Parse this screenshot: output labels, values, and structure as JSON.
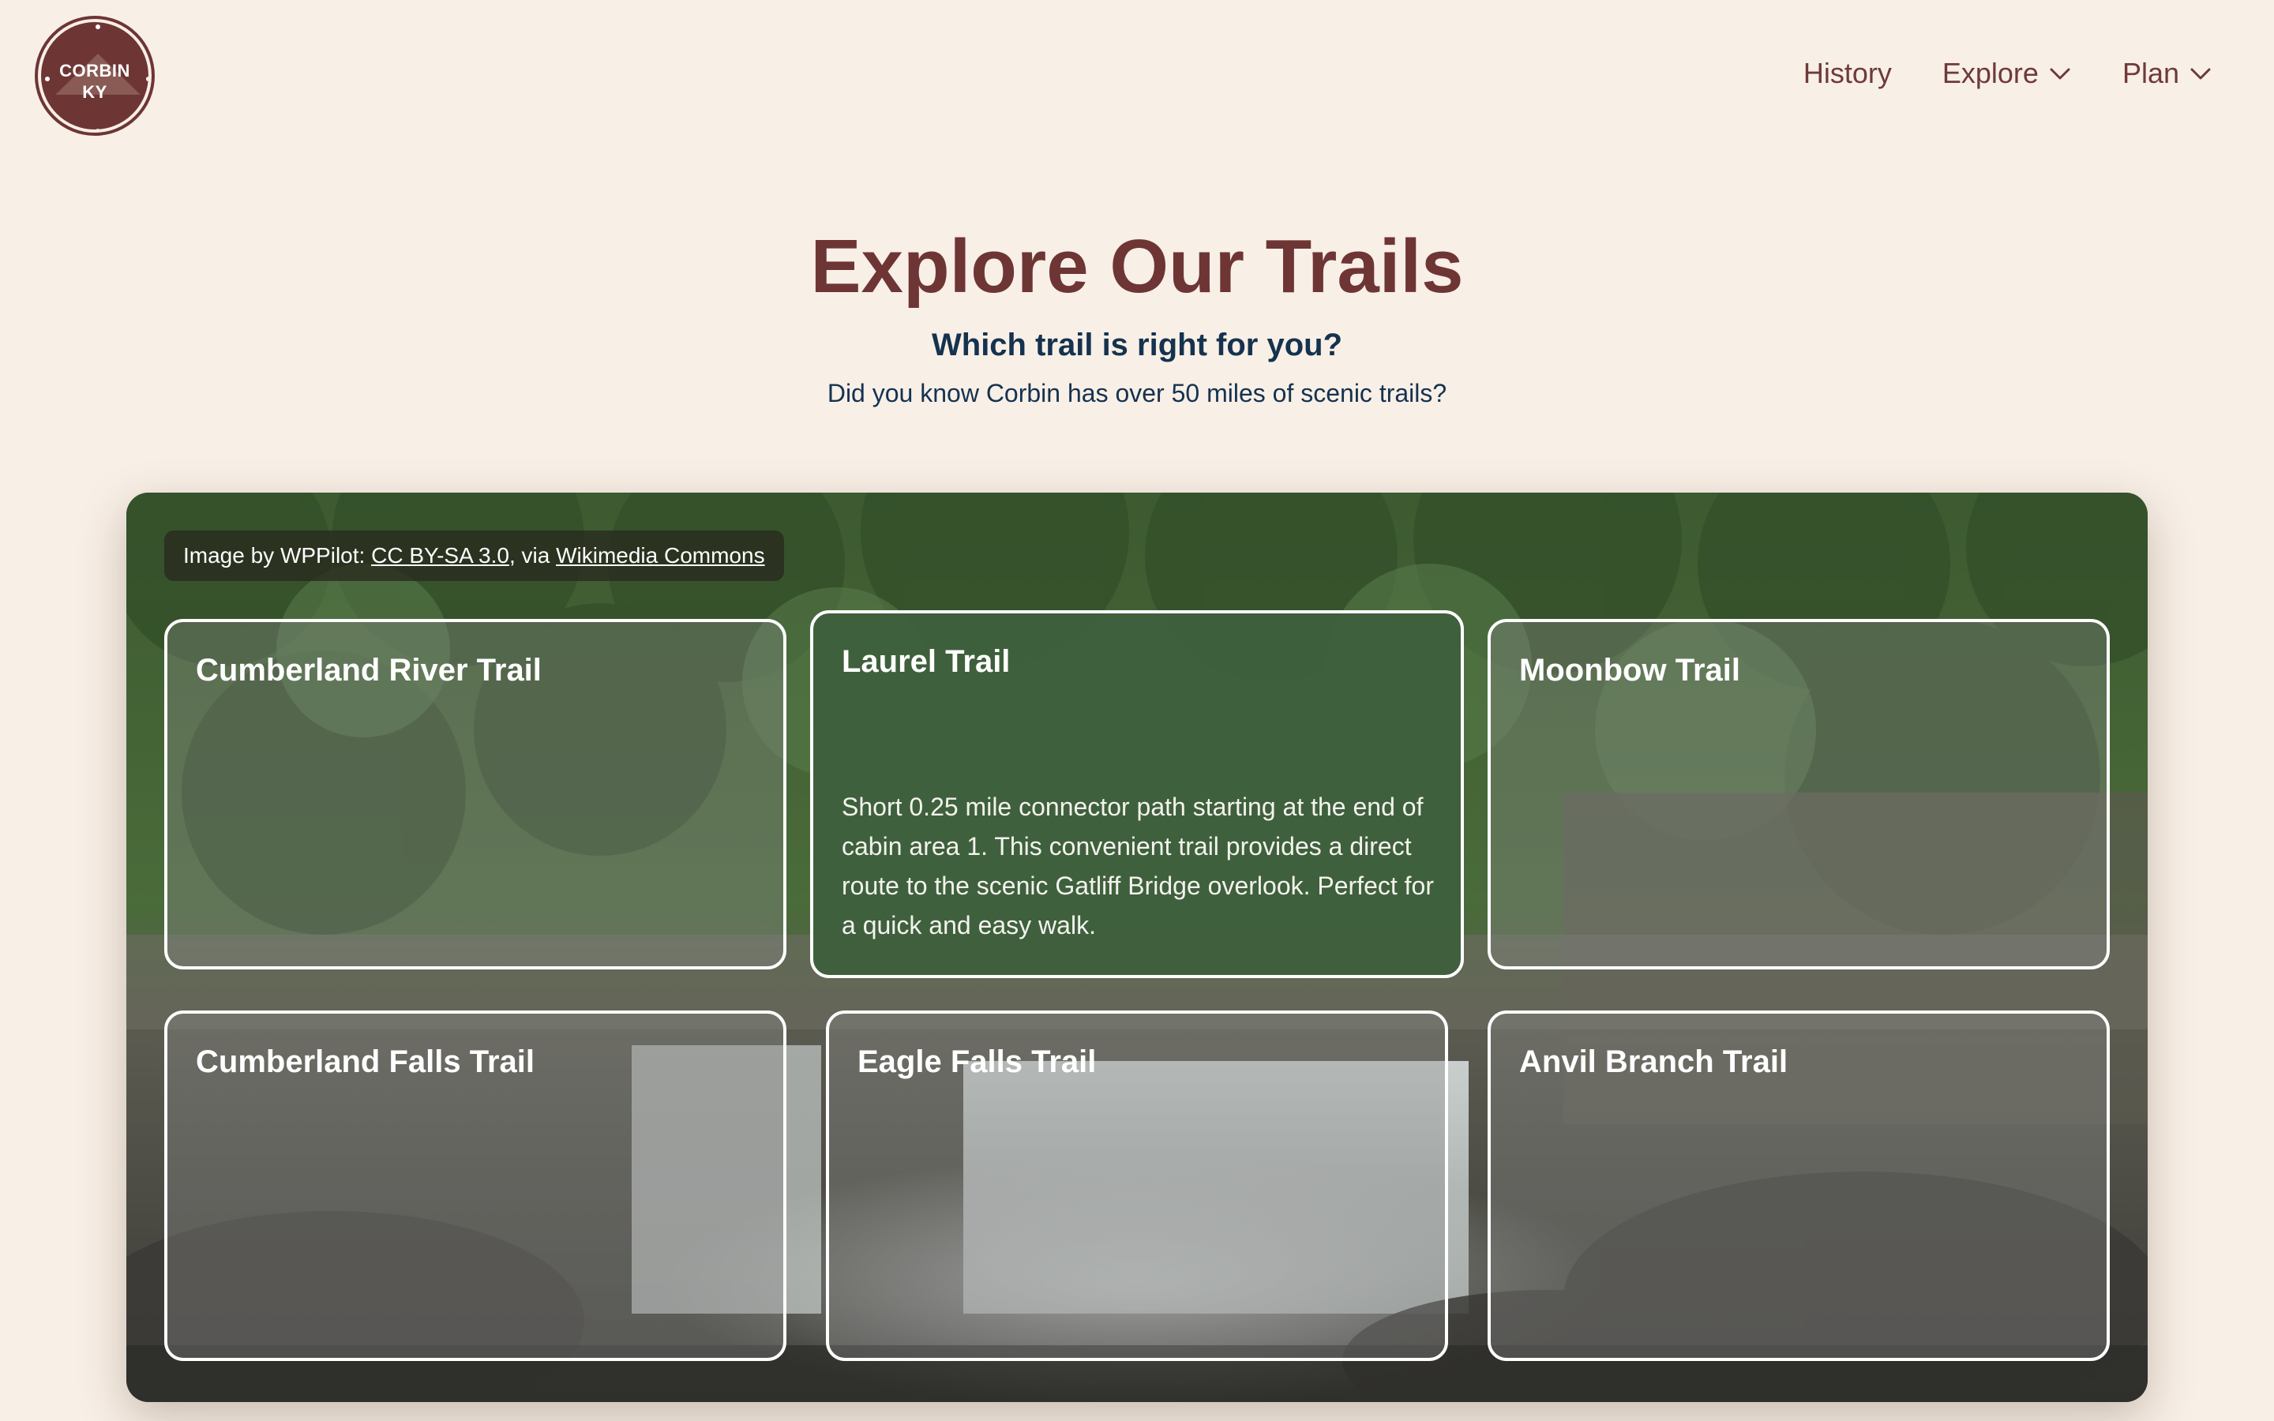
{
  "logo": {
    "line1": "CORBIN",
    "line2": "KY"
  },
  "nav": {
    "history": "History",
    "explore": "Explore",
    "plan": "Plan"
  },
  "hero": {
    "title": "Explore Our Trails",
    "subtitle": "Which trail is right for you?",
    "tagline": "Did you know Corbin has over 50 miles of scenic trails?"
  },
  "credit": {
    "prefix": "Image by WPPilot: ",
    "license": "CC BY-SA 3.0",
    "middle": ", via ",
    "source": "Wikimedia Commons"
  },
  "trails": [
    {
      "name": "Cumberland River Trail"
    },
    {
      "name": "Laurel Trail",
      "description": "Short 0.25 mile connector path starting at the end of cabin area 1. This convenient trail provides a direct route to the scenic Gatliff Bridge overlook. Perfect for a quick and easy walk."
    },
    {
      "name": "Moonbow Trail"
    },
    {
      "name": "Cumberland Falls Trail"
    },
    {
      "name": "Eagle Falls Trail"
    },
    {
      "name": "Anvil Branch Trail"
    }
  ],
  "colors": {
    "background": "#f8efe6",
    "brand": "#6e3535",
    "heading_navy": "#15324f",
    "active_card": "#3e603c"
  }
}
